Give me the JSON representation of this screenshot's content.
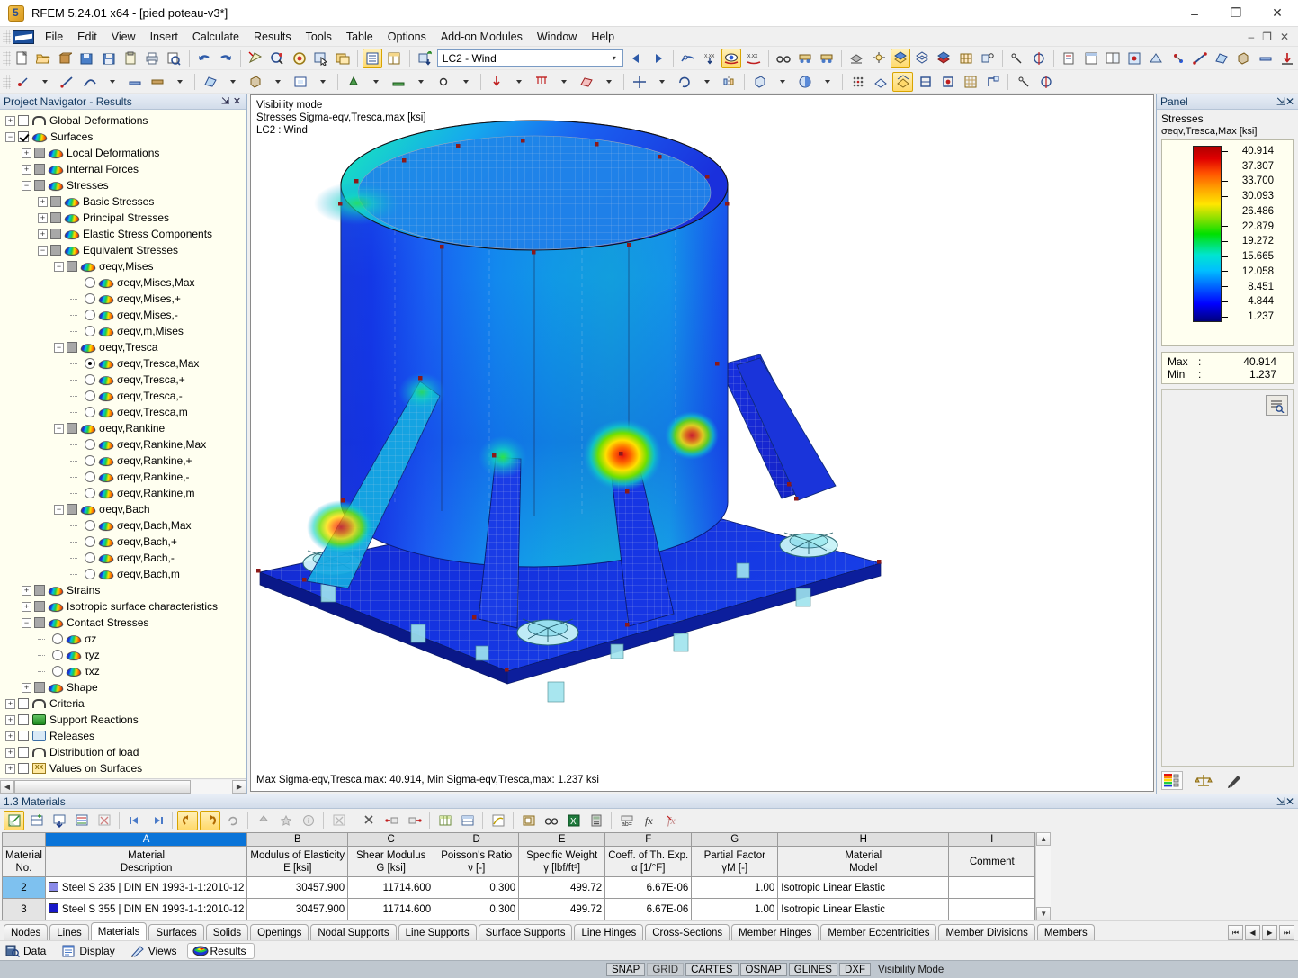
{
  "window": {
    "title": "RFEM 5.24.01 x64 - [pied poteau-v3*]",
    "minimize": "–",
    "maximize": "❐",
    "close": "✕",
    "inner_minimize": "–",
    "inner_restore": "❐",
    "inner_close": "✕"
  },
  "menu": {
    "items": [
      "File",
      "Edit",
      "View",
      "Insert",
      "Calculate",
      "Results",
      "Tools",
      "Table",
      "Options",
      "Add-on Modules",
      "Window",
      "Help"
    ]
  },
  "toolbar": {
    "loadcase_value": "LC2 - Wind",
    "loadcase_arrow": "▾"
  },
  "navigator": {
    "title": "Project Navigator - Results",
    "pin": "⇲",
    "close": "✕",
    "tree": [
      {
        "level": 0,
        "expander": "+",
        "box": "checkbox",
        "checked": false,
        "icon": "arch",
        "label": "Global Deformations"
      },
      {
        "level": 0,
        "expander": "−",
        "box": "checkbox",
        "checked": true,
        "icon": "surface",
        "label": "Surfaces"
      },
      {
        "level": 1,
        "expander": "+",
        "box": "checkbox-gray",
        "icon": "surface",
        "label": "Local Deformations"
      },
      {
        "level": 1,
        "expander": "+",
        "box": "checkbox-gray",
        "icon": "surface",
        "label": "Internal Forces"
      },
      {
        "level": 1,
        "expander": "−",
        "box": "checkbox-gray",
        "icon": "surface",
        "label": "Stresses"
      },
      {
        "level": 2,
        "expander": "+",
        "box": "checkbox-gray",
        "icon": "surface",
        "label": "Basic Stresses"
      },
      {
        "level": 2,
        "expander": "+",
        "box": "checkbox-gray",
        "icon": "surface",
        "label": "Principal Stresses"
      },
      {
        "level": 2,
        "expander": "+",
        "box": "checkbox-gray",
        "icon": "surface",
        "label": "Elastic Stress Components"
      },
      {
        "level": 2,
        "expander": "−",
        "box": "checkbox-gray",
        "icon": "surface",
        "label": "Equivalent Stresses"
      },
      {
        "level": 3,
        "expander": "−",
        "box": "checkbox-gray",
        "icon": "surface",
        "label": "σeqv,Mises"
      },
      {
        "level": 4,
        "expander": "",
        "box": "radio",
        "selected": false,
        "icon": "surface",
        "label": "σeqv,Mises,Max"
      },
      {
        "level": 4,
        "expander": "",
        "box": "radio",
        "selected": false,
        "icon": "surface",
        "label": "σeqv,Mises,+"
      },
      {
        "level": 4,
        "expander": "",
        "box": "radio",
        "selected": false,
        "icon": "surface",
        "label": "σeqv,Mises,-"
      },
      {
        "level": 4,
        "expander": "",
        "box": "radio",
        "selected": false,
        "icon": "surface",
        "label": "σeqv,m,Mises"
      },
      {
        "level": 3,
        "expander": "−",
        "box": "checkbox-gray",
        "icon": "surface",
        "label": "σeqv,Tresca"
      },
      {
        "level": 4,
        "expander": "",
        "box": "radio",
        "selected": true,
        "icon": "surface",
        "label": "σeqv,Tresca,Max"
      },
      {
        "level": 4,
        "expander": "",
        "box": "radio",
        "selected": false,
        "icon": "surface",
        "label": "σeqv,Tresca,+"
      },
      {
        "level": 4,
        "expander": "",
        "box": "radio",
        "selected": false,
        "icon": "surface",
        "label": "σeqv,Tresca,-"
      },
      {
        "level": 4,
        "expander": "",
        "box": "radio",
        "selected": false,
        "icon": "surface",
        "label": "σeqv,Tresca,m"
      },
      {
        "level": 3,
        "expander": "−",
        "box": "checkbox-gray",
        "icon": "surface",
        "label": "σeqv,Rankine"
      },
      {
        "level": 4,
        "expander": "",
        "box": "radio",
        "selected": false,
        "icon": "surface",
        "label": "σeqv,Rankine,Max"
      },
      {
        "level": 4,
        "expander": "",
        "box": "radio",
        "selected": false,
        "icon": "surface",
        "label": "σeqv,Rankine,+"
      },
      {
        "level": 4,
        "expander": "",
        "box": "radio",
        "selected": false,
        "icon": "surface",
        "label": "σeqv,Rankine,-"
      },
      {
        "level": 4,
        "expander": "",
        "box": "radio",
        "selected": false,
        "icon": "surface",
        "label": "σeqv,Rankine,m"
      },
      {
        "level": 3,
        "expander": "−",
        "box": "checkbox-gray",
        "icon": "surface",
        "label": "σeqv,Bach"
      },
      {
        "level": 4,
        "expander": "",
        "box": "radio",
        "selected": false,
        "icon": "surface",
        "label": "σeqv,Bach,Max"
      },
      {
        "level": 4,
        "expander": "",
        "box": "radio",
        "selected": false,
        "icon": "surface",
        "label": "σeqv,Bach,+"
      },
      {
        "level": 4,
        "expander": "",
        "box": "radio",
        "selected": false,
        "icon": "surface",
        "label": "σeqv,Bach,-"
      },
      {
        "level": 4,
        "expander": "",
        "box": "radio",
        "selected": false,
        "icon": "surface",
        "label": "σeqv,Bach,m"
      },
      {
        "level": 1,
        "expander": "+",
        "box": "checkbox-gray",
        "icon": "surface",
        "label": "Strains"
      },
      {
        "level": 1,
        "expander": "+",
        "box": "checkbox-gray",
        "icon": "surface",
        "label": "Isotropic surface characteristics"
      },
      {
        "level": 1,
        "expander": "−",
        "box": "checkbox-gray",
        "icon": "surface",
        "label": "Contact Stresses"
      },
      {
        "level": 2,
        "expander": "",
        "box": "radio",
        "selected": false,
        "icon": "surface",
        "label": "σz"
      },
      {
        "level": 2,
        "expander": "",
        "box": "radio",
        "selected": false,
        "icon": "surface",
        "label": "τyz"
      },
      {
        "level": 2,
        "expander": "",
        "box": "radio",
        "selected": false,
        "icon": "surface",
        "label": "τxz"
      },
      {
        "level": 1,
        "expander": "+",
        "box": "checkbox-gray",
        "icon": "surface",
        "label": "Shape"
      },
      {
        "level": 0,
        "expander": "+",
        "box": "checkbox",
        "checked": false,
        "icon": "arch",
        "label": "Criteria"
      },
      {
        "level": 0,
        "expander": "+",
        "box": "checkbox",
        "checked": false,
        "icon": "support",
        "label": "Support Reactions"
      },
      {
        "level": 0,
        "expander": "+",
        "box": "checkbox",
        "checked": false,
        "icon": "release",
        "label": "Releases"
      },
      {
        "level": 0,
        "expander": "+",
        "box": "checkbox",
        "checked": false,
        "icon": "arch",
        "label": "Distribution of load"
      },
      {
        "level": 0,
        "expander": "+",
        "box": "checkbox",
        "checked": false,
        "icon": "xx",
        "label": "Values on Surfaces"
      }
    ]
  },
  "viewport": {
    "overlay_line1": "Visibility mode",
    "overlay_line2": "Stresses Sigma-eqv,Tresca,max [ksi]",
    "overlay_line3": "LC2 : Wind",
    "footer": "Max Sigma-eqv,Tresca,max: 40.914, Min Sigma-eqv,Tresca,max: 1.237 ksi"
  },
  "panel": {
    "title": "Panel",
    "pin": "⇲",
    "close": "✕",
    "heading": "Stresses",
    "quantity": "σeqv,Tresca,Max",
    "unit": "[ksi]",
    "max_label": "Max",
    "min_label": "Min",
    "colon": ":",
    "max_value": "40.914",
    "min_value": "1.237"
  },
  "chart_data": {
    "type": "heatmap",
    "title": "Stresses σeqv,Tresca,Max [ksi]",
    "legend_position": "right",
    "unit": "ksi",
    "colorbar_scale": [
      40.914,
      37.307,
      33.7,
      30.093,
      26.486,
      22.879,
      19.272,
      15.665,
      12.058,
      8.451,
      4.844,
      1.237
    ],
    "colors": [
      "#c00000",
      "#ff0000",
      "#ff5a00",
      "#ff9a00",
      "#ffd400",
      "#eaff00",
      "#48e000",
      "#00dca0",
      "#00c8e8",
      "#0090ff",
      "#0040ff",
      "#000080"
    ],
    "vmin": 1.237,
    "vmax": 40.914,
    "load_case": "LC2 - Wind",
    "result_type": "Sigma-eqv,Tresca,max"
  },
  "table": {
    "title": "1.3 Materials",
    "pin": "⇲",
    "close": "✕",
    "column_letters": [
      "A",
      "B",
      "C",
      "D",
      "E",
      "F",
      "G",
      "H",
      "I"
    ],
    "selected_letter": "A",
    "row_header": {
      "line1": "Material",
      "line2": "No."
    },
    "headers": [
      {
        "line1": "Material",
        "line2": "Description"
      },
      {
        "line1": "Modulus of Elasticity",
        "line2": "E [ksi]"
      },
      {
        "line1": "Shear Modulus",
        "line2": "G [ksi]"
      },
      {
        "line1": "Poisson's Ratio",
        "line2": "ν [-]"
      },
      {
        "line1": "Specific Weight",
        "line2": "γ [lbf/ft³]"
      },
      {
        "line1": "Coeff. of Th. Exp.",
        "line2": "α [1/°F]"
      },
      {
        "line1": "Partial Factor",
        "line2": "γM [-]"
      },
      {
        "line1": "Material",
        "line2": "Model"
      },
      {
        "line1": "",
        "line2": "Comment"
      }
    ],
    "rows": [
      {
        "no": "2",
        "selected": true,
        "swatch": "#8a8ae8",
        "description": "Steel S 235 | DIN EN 1993-1-1:2010-12",
        "e": "30457.900",
        "g": "11714.600",
        "nu": "0.300",
        "gamma": "499.72",
        "alpha": "6.67E-06",
        "gammaM": "1.00",
        "model": "Isotropic Linear Elastic",
        "comment": ""
      },
      {
        "no": "3",
        "selected": false,
        "swatch": "#1818c8",
        "description": "Steel S 355 | DIN EN 1993-1-1:2010-12",
        "e": "30457.900",
        "g": "11714.600",
        "nu": "0.300",
        "gamma": "499.72",
        "alpha": "6.67E-06",
        "gammaM": "1.00",
        "model": "Isotropic Linear Elastic",
        "comment": ""
      }
    ]
  },
  "bottom_tabs": {
    "selected": "Materials",
    "items": [
      "Nodes",
      "Lines",
      "Materials",
      "Surfaces",
      "Solids",
      "Openings",
      "Nodal Supports",
      "Line Supports",
      "Surface Supports",
      "Line Hinges",
      "Cross-Sections",
      "Member Hinges",
      "Member Eccentricities",
      "Member Divisions",
      "Members"
    ],
    "nav_first": "⏮",
    "nav_prev": "◀",
    "nav_next": "▶",
    "nav_last": "⏭"
  },
  "mode_bar": {
    "items": [
      {
        "label": "Data",
        "icon": "data-icon",
        "selected": false
      },
      {
        "label": "Display",
        "icon": "display-icon",
        "selected": false
      },
      {
        "label": "Views",
        "icon": "views-icon",
        "selected": false
      },
      {
        "label": "Results",
        "icon": "results-icon",
        "selected": true
      }
    ]
  },
  "status_bar": {
    "flags": [
      {
        "label": "SNAP",
        "active": true
      },
      {
        "label": "GRID",
        "active": false
      },
      {
        "label": "CARTES",
        "active": true
      },
      {
        "label": "OSNAP",
        "active": true
      },
      {
        "label": "GLINES",
        "active": true
      },
      {
        "label": "DXF",
        "active": true
      }
    ],
    "message": "Visibility Mode"
  },
  "scroll": {
    "left": "◀",
    "right": "▶",
    "up": "▲",
    "down": "▼"
  }
}
